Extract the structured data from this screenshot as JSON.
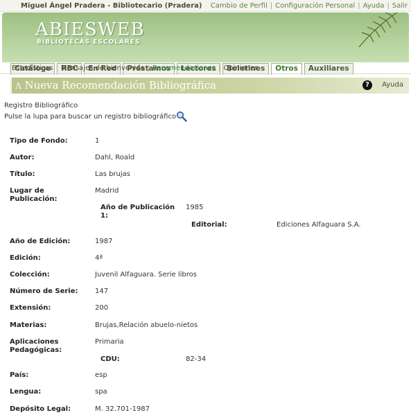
{
  "topbar": {
    "user": "Miguel Ángel Pradera - Bibliotecario (Pradera)",
    "links": [
      "Cambio de Perfil",
      "Configuración Personal",
      "Ayuda",
      "Salir"
    ]
  },
  "brand": {
    "name": "ABIESWEB",
    "subtitle": "BIBLIOTECAS ESCOLARES"
  },
  "tabs": [
    "Catálogo",
    "RBC",
    "En Red",
    "Préstamos",
    "Lectores",
    "Boletines",
    "Otros",
    "Auxiliares"
  ],
  "active_tab": "Otros",
  "subtabs": [
    "Estadísticas",
    "Mensajes de bienvenida",
    "Recomendaciones",
    "Opiniones"
  ],
  "active_subtab": "Recomendaciones",
  "page_title": "Nueva Recomendación Bibliográfica",
  "help_label": "Ayuda",
  "registry": {
    "label": "Registro Bibliográfico",
    "hint": "Pulse la lupa para buscar un registro bibliográfico"
  },
  "fields": {
    "tipo_fondo": {
      "label": "Tipo de Fondo:",
      "value": "1"
    },
    "autor": {
      "label": "Autor:",
      "value": "Dahl, Roald"
    },
    "titulo": {
      "label": "Título:",
      "value": "Las brujas"
    },
    "lugar": {
      "label": "Lugar de Publicación:",
      "value": "Madrid"
    },
    "anio_pub": {
      "label": "Año de Publicación 1:",
      "value": "1985"
    },
    "editorial": {
      "label": "Editorial:",
      "value": "Ediciones Alfaguara S.A."
    },
    "anio_edicion": {
      "label": "Año de Edición:",
      "value": "1987"
    },
    "edicion": {
      "label": "Edición:",
      "value": "4ª"
    },
    "coleccion": {
      "label": "Colección:",
      "value": "Juvenil Alfaguara. Serie libros"
    },
    "numero_serie": {
      "label": "Número de Serie:",
      "value": "147"
    },
    "extension": {
      "label": "Extensión:",
      "value": "200"
    },
    "materias": {
      "label": "Materias:",
      "value": "Brujas,Relación abuelo-nietos"
    },
    "aplicaciones": {
      "label": "Aplicaciones Pedagógicas:",
      "value": "Primaria"
    },
    "cdu": {
      "label": "CDU:",
      "value": "82-34"
    },
    "pais": {
      "label": "País:",
      "value": "esp"
    },
    "lengua": {
      "label": "Lengua:",
      "value": "spa"
    },
    "deposito": {
      "label": "Depósito Legal:",
      "value": "M. 32.701-1987"
    }
  }
}
